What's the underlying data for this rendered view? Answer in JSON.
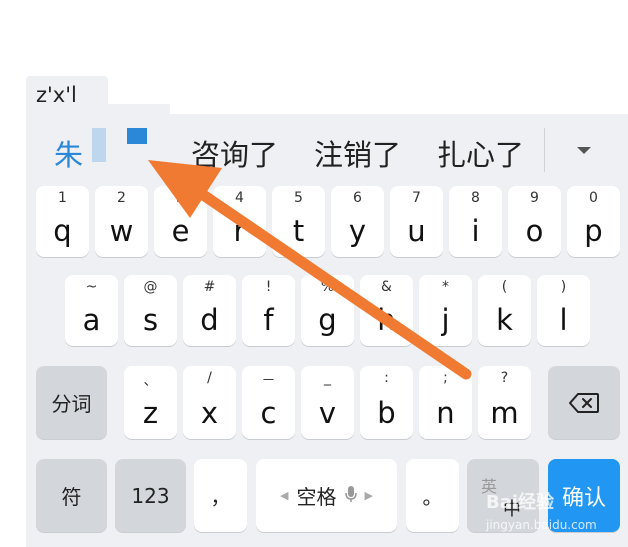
{
  "composition": {
    "pinyin": "z'x'l"
  },
  "candidates": [
    "朱",
    "咨询了",
    "注销了",
    "扎心了"
  ],
  "row1": [
    {
      "ch": "q",
      "num": "1"
    },
    {
      "ch": "w",
      "num": "2"
    },
    {
      "ch": "e",
      "num": "3"
    },
    {
      "ch": "r",
      "num": "4"
    },
    {
      "ch": "t",
      "num": "5"
    },
    {
      "ch": "y",
      "num": "6"
    },
    {
      "ch": "u",
      "num": "7"
    },
    {
      "ch": "i",
      "num": "8"
    },
    {
      "ch": "o",
      "num": "9"
    },
    {
      "ch": "p",
      "num": "0"
    }
  ],
  "row2": [
    {
      "ch": "a",
      "num": "~"
    },
    {
      "ch": "s",
      "num": "@"
    },
    {
      "ch": "d",
      "num": "#"
    },
    {
      "ch": "f",
      "num": "!"
    },
    {
      "ch": "g",
      "num": "%"
    },
    {
      "ch": "h",
      "num": "&"
    },
    {
      "ch": "j",
      "num": "*"
    },
    {
      "ch": "k",
      "num": "("
    },
    {
      "ch": "l",
      "num": ")"
    }
  ],
  "row3": [
    {
      "ch": "z",
      "num": "、"
    },
    {
      "ch": "x",
      "num": "/"
    },
    {
      "ch": "c",
      "num": "－"
    },
    {
      "ch": "v",
      "num": "_"
    },
    {
      "ch": "b",
      "num": ":"
    },
    {
      "ch": "n",
      "num": ";"
    },
    {
      "ch": "m",
      "num": "?"
    }
  ],
  "keys": {
    "segment": "分词",
    "symbols": "符",
    "numbers": "123",
    "comma": "，",
    "space": "空格",
    "period": "。",
    "lang_en": "英",
    "lang_cn": "中",
    "confirm": "确认"
  },
  "watermark": {
    "text": "Bai经验",
    "sub": "jingyan.baidu.com"
  },
  "colors": {
    "accent": "#2196f3",
    "candidate_highlight": "#2b88d8",
    "arrow": "#f07a32"
  },
  "icons": [
    "expand-candidates-icon",
    "backspace-icon",
    "microphone-icon",
    "arrow-annotation-icon"
  ]
}
